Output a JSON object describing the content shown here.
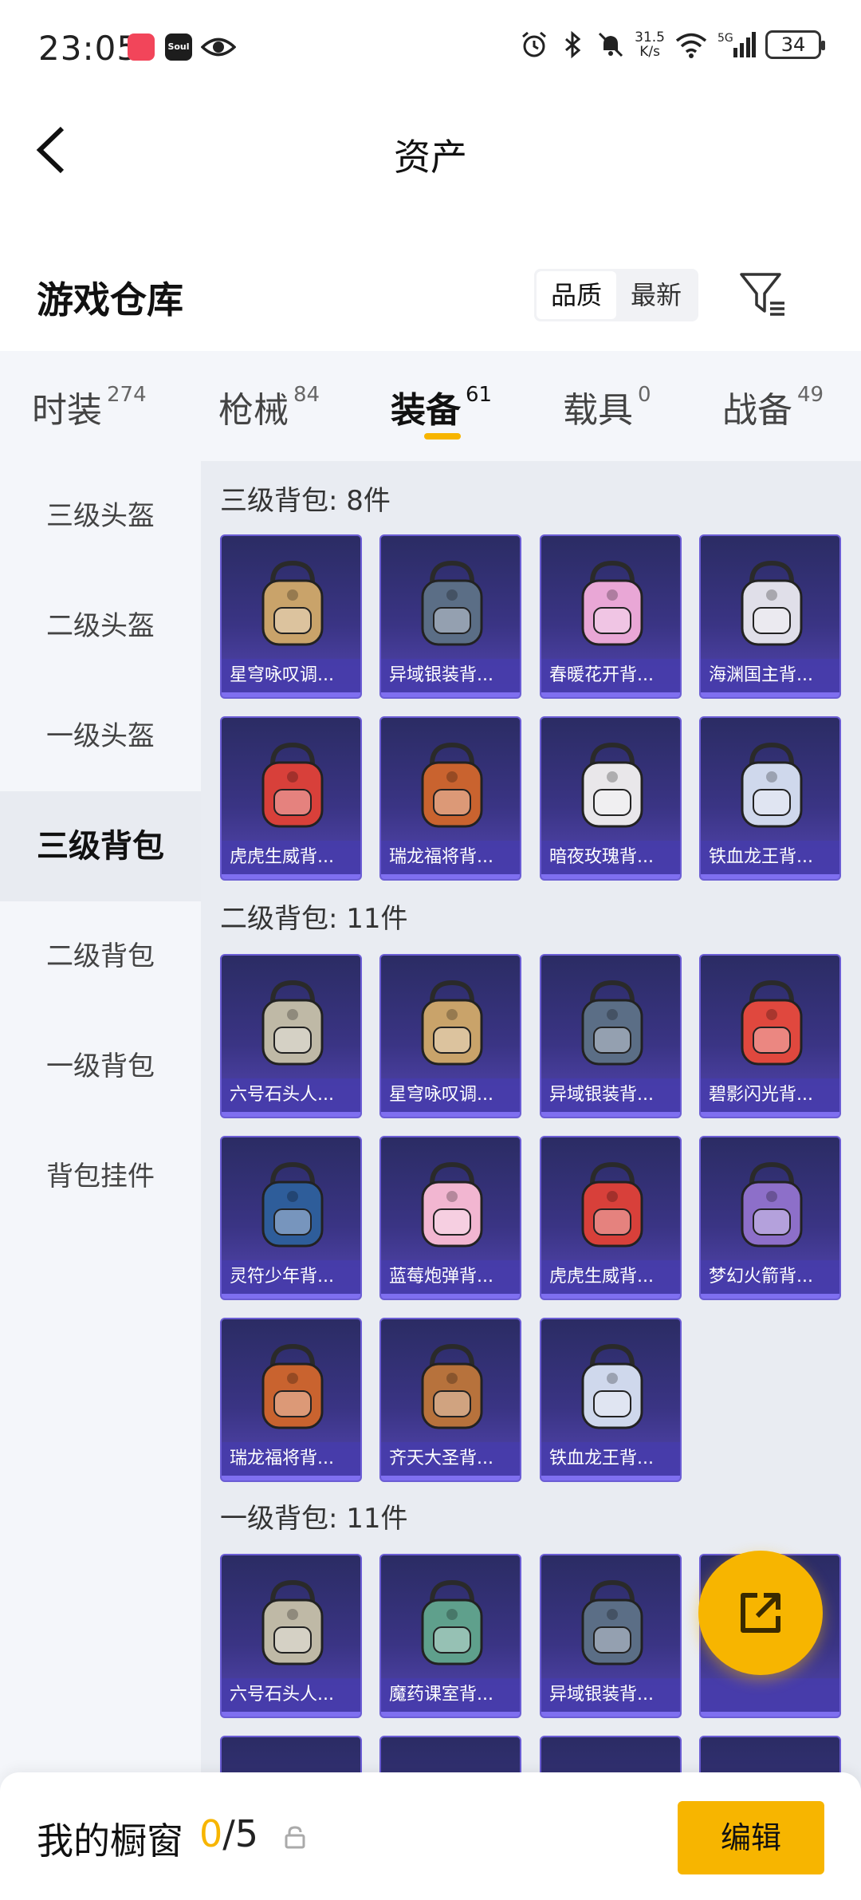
{
  "status_bar": {
    "time": "23:05",
    "speed_value": "31.5",
    "speed_unit": "K/s",
    "network": "5G",
    "battery": "34",
    "soul_app": "Soul"
  },
  "header": {
    "title": "资产"
  },
  "warehouse": {
    "title": "游戏仓库",
    "sort_options": [
      "品质",
      "最新"
    ]
  },
  "tabs": [
    {
      "label": "时装",
      "count": "274"
    },
    {
      "label": "枪械",
      "count": "84"
    },
    {
      "label": "装备",
      "count": "61"
    },
    {
      "label": "载具",
      "count": "0"
    },
    {
      "label": "战备",
      "count": "49"
    }
  ],
  "sidebar": {
    "items": [
      "三级头盔",
      "二级头盔",
      "一级头盔",
      "三级背包",
      "二级背包",
      "一级背包",
      "背包挂件"
    ]
  },
  "sections": [
    {
      "title": "三级背包: 8件",
      "items": [
        "星穹咏叹调...",
        "异域银装背...",
        "春暖花开背...",
        "海渊国主背...",
        "虎虎生威背...",
        "瑞龙福将背...",
        "暗夜玫瑰背...",
        "铁血龙王背..."
      ]
    },
    {
      "title": "二级背包: 11件",
      "items": [
        "六号石头人...",
        "星穹咏叹调...",
        "异域银装背...",
        "碧影闪光背...",
        "灵符少年背...",
        "蓝莓炮弹背...",
        "虎虎生威背...",
        "梦幻火箭背...",
        "瑞龙福将背...",
        "齐天大圣背...",
        "铁血龙王背..."
      ]
    },
    {
      "title": "一级背包: 11件",
      "items": [
        "六号石头人...",
        "魔药课室背...",
        "异域银装背...",
        ""
      ]
    }
  ],
  "bottom_bar": {
    "title": "我的橱窗",
    "current": "0",
    "total": "/5",
    "edit_label": "编辑"
  },
  "colors": {
    "accent": "#f7b500",
    "card_bg": "#3a3484",
    "card_border": "#6b5dd4"
  }
}
